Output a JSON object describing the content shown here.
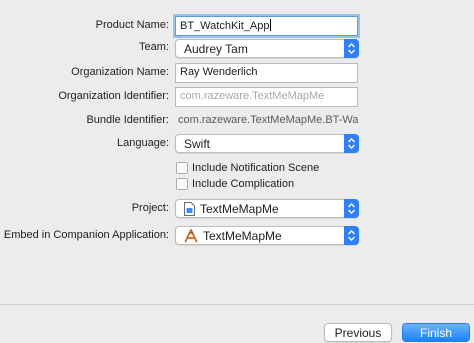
{
  "form": {
    "product_name_label": "Product Name:",
    "product_name_value": "BT_WatchKit_App",
    "team_label": "Team:",
    "team_value": "Audrey Tam",
    "organization_name_label": "Organization Name:",
    "organization_name_value": "Ray Wenderlich",
    "organization_identifier_label": "Organization Identifier:",
    "organization_identifier_placeholder": "com.razeware.TextMeMapMe",
    "bundle_identifier_label": "Bundle Identifier:",
    "bundle_identifier_value": "com.razeware.TextMeMapMe.BT-Wat...",
    "language_label": "Language:",
    "language_value": "Swift",
    "include_notification_label": "Include Notification Scene",
    "include_complication_label": "Include Complication",
    "project_label": "Project:",
    "project_value": "TextMeMapMe",
    "embed_label": "Embed in Companion Application:",
    "embed_value": "TextMeMapMe"
  },
  "checkboxes": {
    "include_notification_checked": false,
    "include_complication_checked": false
  },
  "icons": {
    "popup_arrows": "up-down-chevron-icon",
    "project_file": "xcode-project-icon",
    "app": "app-icon"
  },
  "footer": {
    "previous_label": "Previous",
    "finish_label": "Finish"
  },
  "colors": {
    "accent": "#2f7ff5",
    "focus_ring": "#9ac2ea",
    "background": "#ececec"
  }
}
